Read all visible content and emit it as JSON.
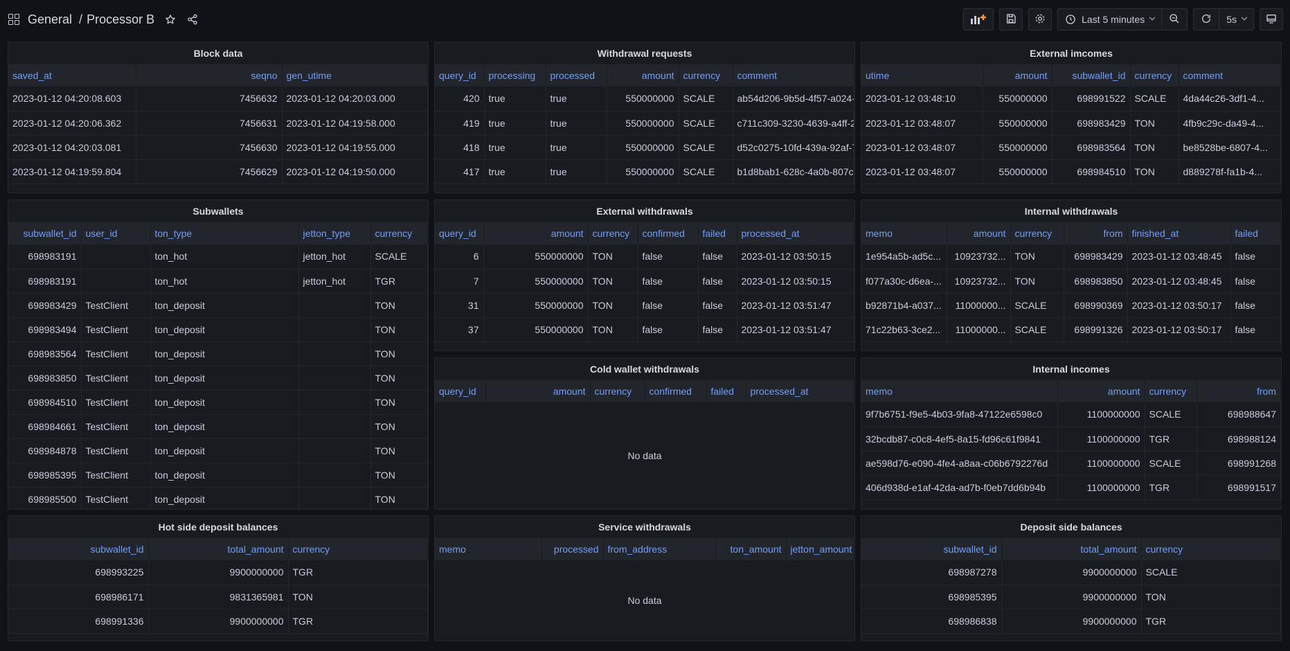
{
  "header": {
    "folder": "General",
    "title": "Processor B"
  },
  "toolbar": {
    "time_range": "Last 5 minutes",
    "refresh": "5s"
  },
  "panels": {
    "block": {
      "title": "Block data",
      "cols": [
        "saved_at",
        "seqno",
        "gen_utime"
      ],
      "rows": [
        [
          "2023-01-12 04:20:08.603",
          "7456632",
          "2023-01-12 04:20:03.000"
        ],
        [
          "2023-01-12 04:20:06.362",
          "7456631",
          "2023-01-12 04:19:58.000"
        ],
        [
          "2023-01-12 04:20:03.081",
          "7456630",
          "2023-01-12 04:19:55.000"
        ],
        [
          "2023-01-12 04:19:59.804",
          "7456629",
          "2023-01-12 04:19:50.000"
        ]
      ]
    },
    "withdrawal": {
      "title": "Withdrawal requests",
      "cols": [
        "query_id",
        "processing",
        "processed",
        "amount",
        "currency",
        "comment"
      ],
      "rows": [
        [
          "420",
          "true",
          "true",
          "550000000",
          "SCALE",
          "ab54d206-9b5d-4f57-a024-"
        ],
        [
          "419",
          "true",
          "true",
          "550000000",
          "SCALE",
          "c711c309-3230-4639-a4ff-2"
        ],
        [
          "418",
          "true",
          "true",
          "550000000",
          "SCALE",
          "d52c0275-10fd-439a-92af-7"
        ],
        [
          "417",
          "true",
          "true",
          "550000000",
          "SCALE",
          "b1d8bab1-628c-4a0b-807c-"
        ]
      ]
    },
    "ext_incomes": {
      "title": "External imcomes",
      "cols": [
        "utime",
        "amount",
        "subwallet_id",
        "currency",
        "comment"
      ],
      "rows": [
        [
          "2023-01-12 03:48:10",
          "550000000",
          "698991522",
          "SCALE",
          "4da44c26-3df1-4..."
        ],
        [
          "2023-01-12 03:48:07",
          "550000000",
          "698983429",
          "TON",
          "4fb9c29c-da49-4..."
        ],
        [
          "2023-01-12 03:48:07",
          "550000000",
          "698983564",
          "TON",
          "be8528be-6807-4..."
        ],
        [
          "2023-01-12 03:48:07",
          "550000000",
          "698984510",
          "TON",
          "d889278f-fa1b-4..."
        ]
      ]
    },
    "subwallets": {
      "title": "Subwallets",
      "cols": [
        "subwallet_id",
        "user_id",
        "ton_type",
        "jetton_type",
        "currency"
      ],
      "rows": [
        [
          "698983191",
          "",
          "ton_hot",
          "jetton_hot",
          "SCALE"
        ],
        [
          "698983191",
          "",
          "ton_hot",
          "jetton_hot",
          "TGR"
        ],
        [
          "698983429",
          "TestClient",
          "ton_deposit",
          "",
          "TON"
        ],
        [
          "698983494",
          "TestClient",
          "ton_deposit",
          "",
          "TON"
        ],
        [
          "698983564",
          "TestClient",
          "ton_deposit",
          "",
          "TON"
        ],
        [
          "698983850",
          "TestClient",
          "ton_deposit",
          "",
          "TON"
        ],
        [
          "698984510",
          "TestClient",
          "ton_deposit",
          "",
          "TON"
        ],
        [
          "698984661",
          "TestClient",
          "ton_deposit",
          "",
          "TON"
        ],
        [
          "698984878",
          "TestClient",
          "ton_deposit",
          "",
          "TON"
        ],
        [
          "698985395",
          "TestClient",
          "ton_deposit",
          "",
          "TON"
        ],
        [
          "698985500",
          "TestClient",
          "ton_deposit",
          "",
          "TON"
        ]
      ]
    },
    "ext_withdrawals": {
      "title": "External withdrawals",
      "cols": [
        "query_id",
        "amount",
        "currency",
        "confirmed",
        "failed",
        "processed_at"
      ],
      "rows": [
        [
          "6",
          "550000000",
          "TON",
          "false",
          "false",
          "2023-01-12 03:50:15"
        ],
        [
          "7",
          "550000000",
          "TON",
          "false",
          "false",
          "2023-01-12 03:50:15"
        ],
        [
          "31",
          "550000000",
          "TON",
          "false",
          "false",
          "2023-01-12 03:51:47"
        ],
        [
          "37",
          "550000000",
          "TON",
          "false",
          "false",
          "2023-01-12 03:51:47"
        ]
      ]
    },
    "int_withdrawals": {
      "title": "Internal withdrawals",
      "cols": [
        "memo",
        "amount",
        "currency",
        "from",
        "finished_at",
        "failed"
      ],
      "rows": [
        [
          "1e954a5b-ad5c...",
          "10923732...",
          "TON",
          "698983429",
          "2023-01-12 03:48:45",
          "false"
        ],
        [
          "f077a30c-d6ea-...",
          "10923732...",
          "TON",
          "698983850",
          "2023-01-12 03:48:45",
          "false"
        ],
        [
          "b92871b4-a037...",
          "11000000...",
          "SCALE",
          "698990369",
          "2023-01-12 03:50:17",
          "false"
        ],
        [
          "71c22b63-3ce2...",
          "11000000...",
          "SCALE",
          "698991326",
          "2023-01-12 03:50:17",
          "false"
        ]
      ]
    },
    "cold": {
      "title": "Cold wallet withdrawals",
      "cols": [
        "query_id",
        "amount",
        "currency",
        "confirmed",
        "failed",
        "processed_at"
      ],
      "empty": "No data"
    },
    "int_incomes": {
      "title": "Internal incomes",
      "cols": [
        "memo",
        "amount",
        "currency",
        "from"
      ],
      "rows": [
        [
          "9f7b6751-f9e5-4b03-9fa8-47122e6598c0",
          "1100000000",
          "SCALE",
          "698988647"
        ],
        [
          "32bcdb87-c0c8-4ef5-8a15-fd96c61f9841",
          "1100000000",
          "TGR",
          "698988124"
        ],
        [
          "ae598d76-e090-4fe4-a8aa-c06b6792276d",
          "1100000000",
          "SCALE",
          "698991268"
        ],
        [
          "406d938d-e1af-42da-ad7b-f0eb7dd6b94b",
          "1100000000",
          "TGR",
          "698991517"
        ]
      ]
    },
    "hot": {
      "title": "Hot side deposit balances",
      "cols": [
        "subwallet_id",
        "total_amount",
        "currency"
      ],
      "rows": [
        [
          "698993225",
          "9900000000",
          "TGR"
        ],
        [
          "698986171",
          "9831365981",
          "TON"
        ],
        [
          "698991336",
          "9900000000",
          "TGR"
        ]
      ]
    },
    "service": {
      "title": "Service withdrawals",
      "cols": [
        "memo",
        "processed",
        "from_address",
        "ton_amount",
        "jetton_amount"
      ],
      "empty": "No data"
    },
    "deposit": {
      "title": "Deposit side balances",
      "cols": [
        "subwallet_id",
        "total_amount",
        "currency"
      ],
      "rows": [
        [
          "698987278",
          "9900000000",
          "SCALE"
        ],
        [
          "698985395",
          "9900000000",
          "TON"
        ],
        [
          "698986838",
          "9900000000",
          "TGR"
        ]
      ]
    }
  }
}
